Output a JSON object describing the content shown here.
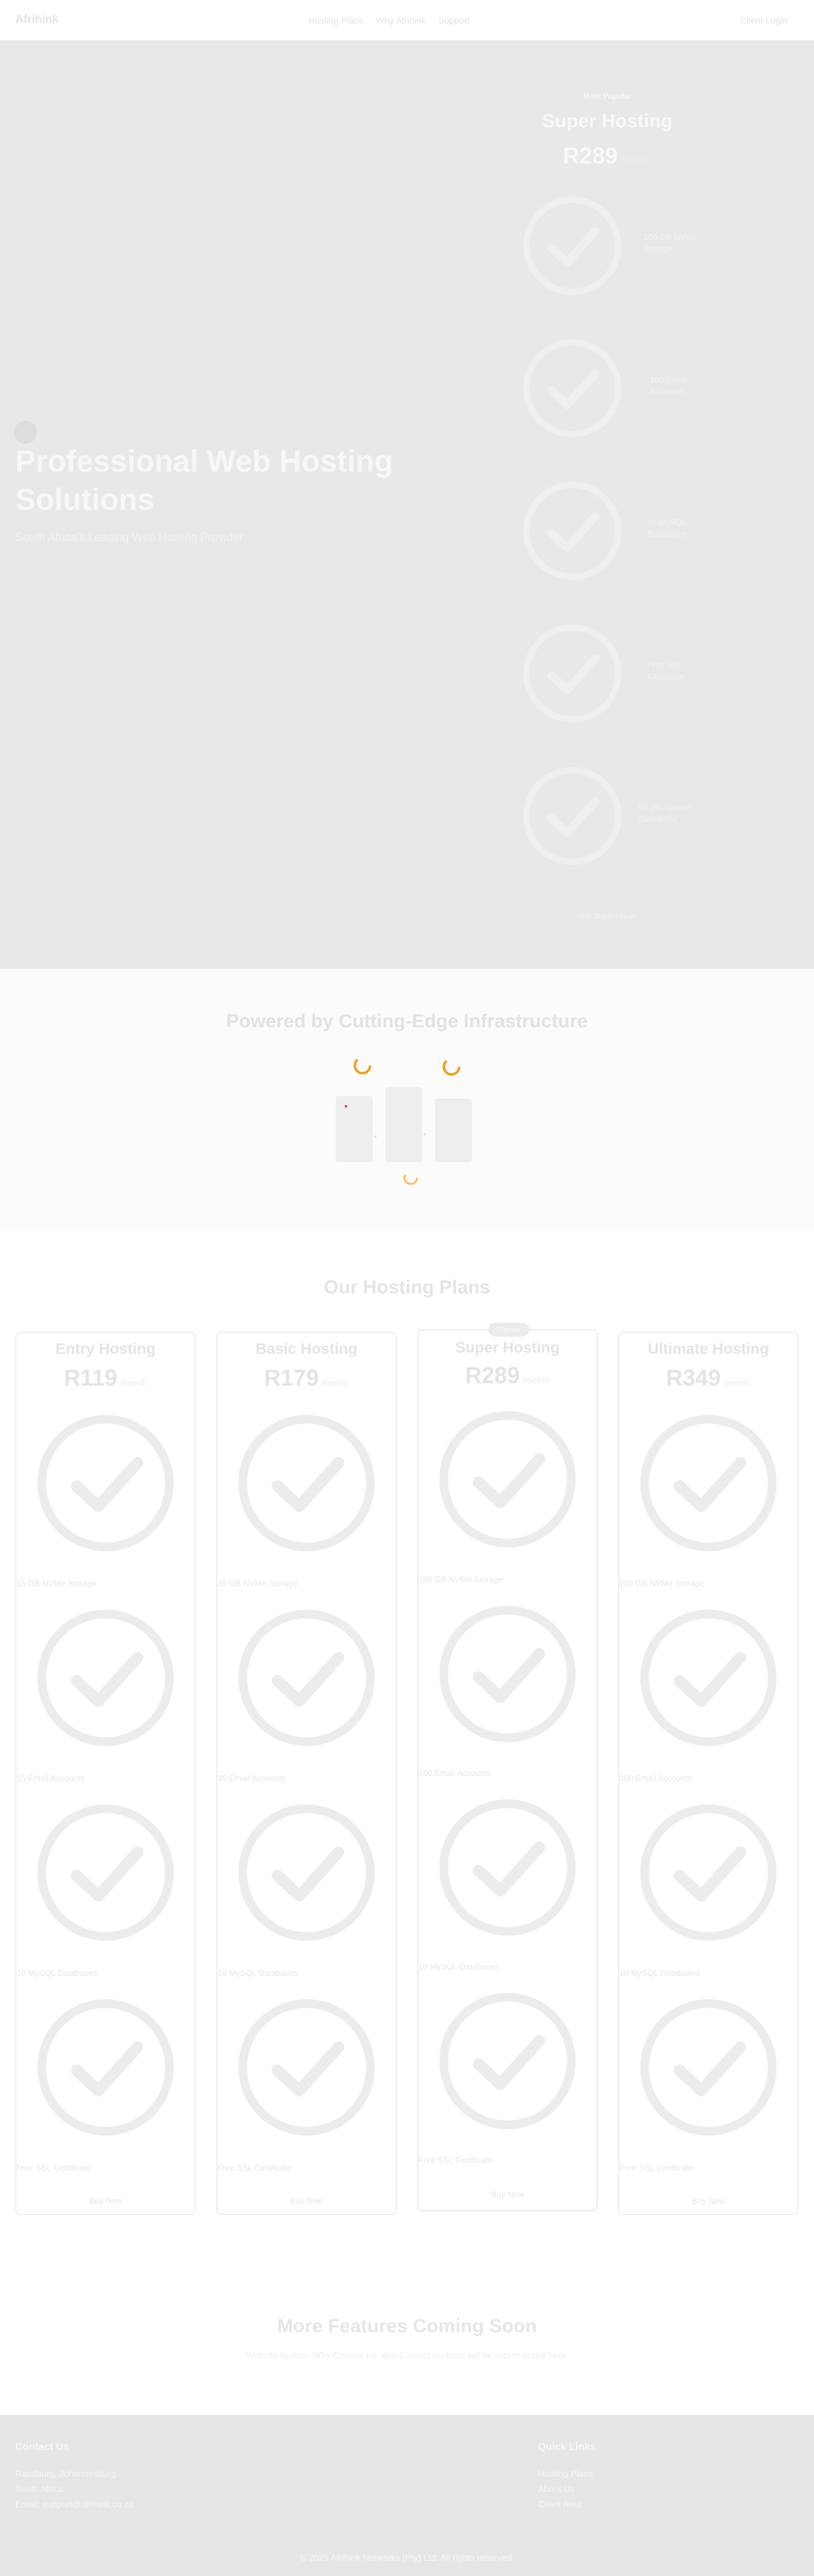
{
  "nav": {
    "logo": "Afrihink",
    "links": [
      "Hosting Plans",
      "Why Afrihink",
      "Support"
    ],
    "client_login": "Client Login"
  },
  "hero": {
    "title": "Professional Web Hosting Solutions",
    "subtitle": "South Africa's Leading Web Hosting Provider",
    "promo": {
      "badge": "Most Popular",
      "name": "Super Hosting",
      "price": "R289",
      "period": "/month",
      "features": [
        "100 GB NVMe Storage",
        "100 Email Accounts",
        "10 MySQL Databases",
        "Free SSL Certificate",
        "99.9% Uptime Guarantee"
      ],
      "cta": "Get Started Now"
    }
  },
  "infrastructure": {
    "title": "Powered by Cutting-Edge Infrastructure"
  },
  "plans": {
    "title": "Our Hosting Plans",
    "popular_badge": "Popular",
    "items": [
      {
        "name": "Entry Hosting",
        "price": "R119",
        "period": "/month",
        "features": [
          "15 GB NVMe Storage",
          "15 Email Accounts",
          "10 MySQL Databases",
          "Free SSL Certificate"
        ],
        "buy": "Buy Now"
      },
      {
        "name": "Basic Hosting",
        "price": "R179",
        "period": "/month",
        "features": [
          "35 GB NVMe Storage",
          "35 Email Accounts",
          "10 MySQL Databases",
          "Free SSL Certificate"
        ],
        "buy": "Buy Now"
      },
      {
        "name": "Super Hosting",
        "price": "R289",
        "period": "/month",
        "features": [
          "100 GB NVMe Storage",
          "100 Email Accounts",
          "10 MySQL Databases",
          "Free SSL Certificate"
        ],
        "buy": "Buy Now"
      },
      {
        "name": "Ultimate Hosting",
        "price": "R349",
        "period": "/month",
        "features": [
          "200 GB NVMe Storage",
          "200 Email Accounts",
          "10 MySQL Databases",
          "Free SSL Certificate"
        ],
        "buy": "Buy Now"
      }
    ]
  },
  "coming_soon": {
    "title": "More Features Coming Soon",
    "text": "Website Builder, Why Choose Us, and Contact sections will be implemented here."
  },
  "footer": {
    "contact_title": "Contact Us",
    "contact_lines": [
      "Randburg, Johannesburg",
      "South Africa",
      "Email: support@afrihink.co.za"
    ],
    "links_title": "Quick Links",
    "links": [
      "Hosting Plans",
      "About Us",
      "Client Area"
    ],
    "copyright": "© 2025 Afrihink Networks (Pty) Ltd. All rights reserved."
  },
  "colors": {
    "hero_bg": "#e8e8e8",
    "footer_bg": "#e6e6e6",
    "accent_orange": "#f0a020"
  }
}
